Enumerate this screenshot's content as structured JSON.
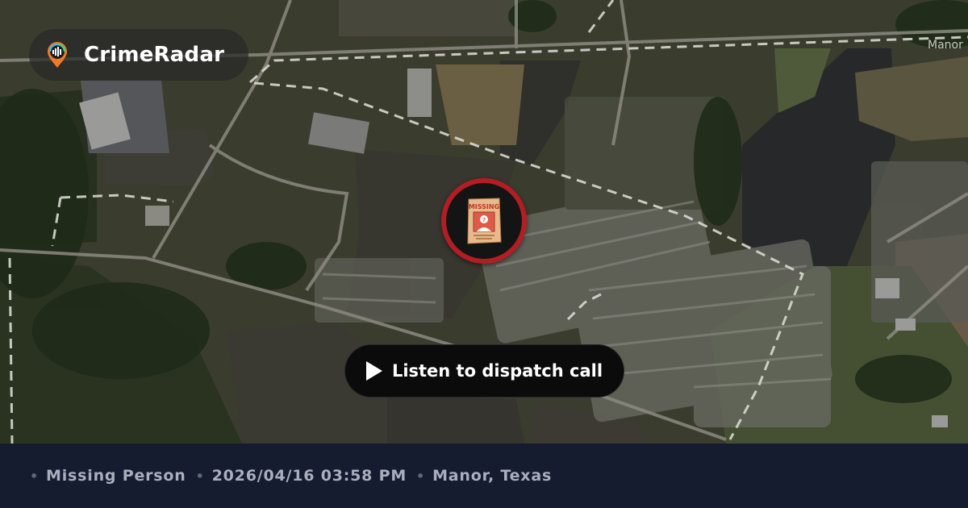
{
  "brand": {
    "name": "CrimeRadar",
    "logo_icon": "radar-pin-icon"
  },
  "map": {
    "place_label": "Manor",
    "marker_icon": "missing-poster-icon",
    "marker_text": "MISSING",
    "marker_color": "#b31d24"
  },
  "player": {
    "button_label": "Listen to dispatch call",
    "icon": "play-icon"
  },
  "footer": {
    "incident_type": "Missing Person",
    "datetime": "2026/04/16 03:58 PM",
    "location": "Manor, Texas",
    "separator": "•"
  },
  "colors": {
    "footer_bg": "#161c30",
    "footer_text": "#a9afbd",
    "button_bg": "#0b0b0b",
    "accent_red": "#b31d24"
  }
}
